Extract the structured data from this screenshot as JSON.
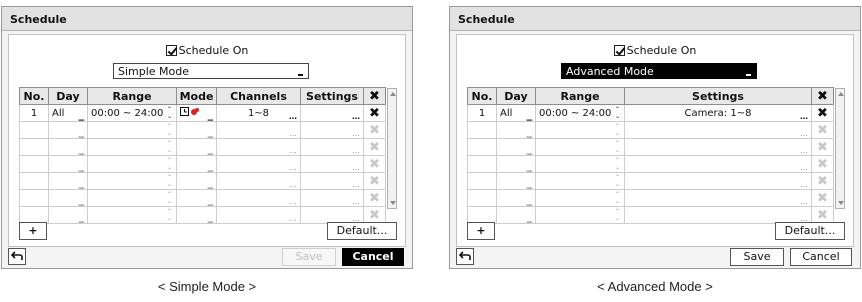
{
  "simple": {
    "title": "Schedule",
    "schedule_on_label": "Schedule On",
    "mode_value": "Simple Mode",
    "headers": [
      "No.",
      "Day",
      "Range",
      "Mode",
      "Channels",
      "Settings"
    ],
    "row1": {
      "no": "1",
      "day": "All",
      "range": "00:00 ~ 24:00",
      "channels": "1~8"
    },
    "add_label": "+",
    "default_label": "Default...",
    "save_label": "Save",
    "cancel_label": "Cancel"
  },
  "advanced": {
    "title": "Schedule",
    "schedule_on_label": "Schedule On",
    "mode_value": "Advanced Mode",
    "headers": [
      "No.",
      "Day",
      "Range",
      "Settings"
    ],
    "row1": {
      "no": "1",
      "day": "All",
      "range": "00:00 ~ 24:00",
      "settings": "Camera: 1~8"
    },
    "add_label": "+",
    "default_label": "Default...",
    "save_label": "Save",
    "cancel_label": "Cancel"
  },
  "captions": {
    "simple": "< Simple Mode >",
    "advanced": "< Advanced Mode >"
  },
  "colors": {
    "selected_bg": "#000000",
    "header_bg": "#e8e8e8",
    "dialog_bg": "#f4f4f4"
  },
  "icons": {
    "delete": "x-icon",
    "back": "back-arrow-icon",
    "mode": "record-mode-icon"
  }
}
